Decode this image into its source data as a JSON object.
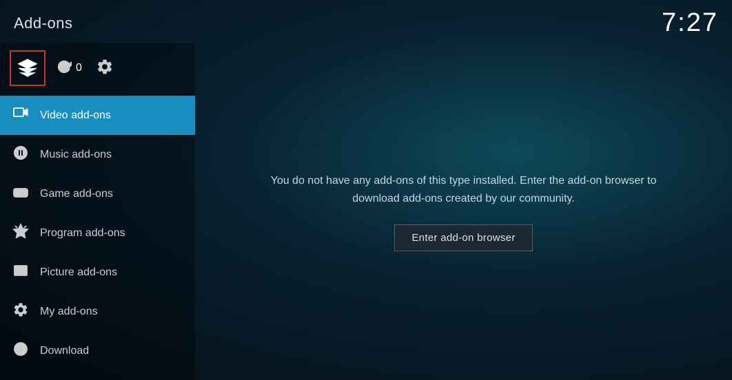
{
  "header": {
    "title": "Add-ons",
    "time": "7:27"
  },
  "toolbar": {
    "refresh_count": "0"
  },
  "sidebar": {
    "items": [
      {
        "id": "video",
        "label": "Video add-ons",
        "icon": "video-icon",
        "active": true
      },
      {
        "id": "music",
        "label": "Music add-ons",
        "icon": "music-icon",
        "active": false
      },
      {
        "id": "game",
        "label": "Game add-ons",
        "icon": "game-icon",
        "active": false
      },
      {
        "id": "program",
        "label": "Program add-ons",
        "icon": "program-icon",
        "active": false
      },
      {
        "id": "picture",
        "label": "Picture add-ons",
        "icon": "picture-icon",
        "active": false
      },
      {
        "id": "myaddon",
        "label": "My add-ons",
        "icon": "myaddon-icon",
        "active": false
      },
      {
        "id": "download",
        "label": "Download",
        "icon": "download-icon",
        "active": false
      }
    ]
  },
  "main": {
    "info_text": "You do not have any add-ons of this type installed. Enter the add-on browser to download add-ons created by our community.",
    "browser_button": "Enter add-on browser"
  }
}
